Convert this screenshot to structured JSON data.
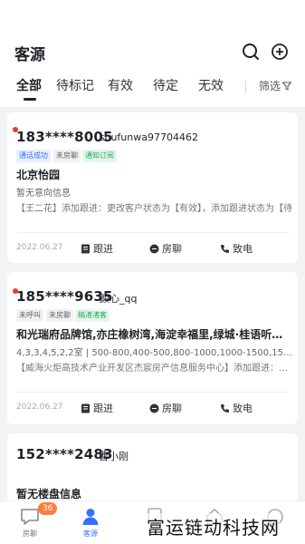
{
  "header": {
    "title": "客源"
  },
  "tabs": [
    {
      "label": "全部"
    },
    {
      "label": "待标记"
    },
    {
      "label": "有效"
    },
    {
      "label": "待定"
    },
    {
      "label": "无效"
    }
  ],
  "filter": {
    "label": "筛选"
  },
  "cards": [
    {
      "phone": "183****8005",
      "nickname": "soufunwa97704462",
      "tags": [
        "通话成功",
        "未房聊",
        "通知订阅"
      ],
      "estate": "北京怡园",
      "intent": "暂无意向信息",
      "follow": "【王二花】添加跟进：更改客户状态为【有效】，添加跟进状态为【待",
      "date": "2022.06.27",
      "actions": [
        "跟进",
        "房聊",
        "致电"
      ]
    },
    {
      "phone": "185****9635",
      "nickname": "颜心_qq",
      "tags": [
        "未呼叫",
        "未房聊",
        "稿渚渚客"
      ],
      "estate": "和光瑞府品牌馆,亦庄橡树湾,海淀幸福里,绿城·桂语听澜,...",
      "intent": "4,3,3,4,5,2,2室 | 500-800,400-500,800-1000,1000-1500,1500-...",
      "follow": "【威海火炬高技术产业开发区杰宸房产信息服务中心】添加跟进：更改客户",
      "date": "2022.06.27",
      "actions": [
        "跟进",
        "房聊",
        "致电"
      ]
    },
    {
      "phone": "152****2483",
      "nickname": "曹小刚",
      "estate": "暂无楼盘信息"
    }
  ],
  "bottom_nav": {
    "items": [
      {
        "label": "房聊",
        "badge": "36"
      },
      {
        "label": "客源"
      }
    ]
  },
  "watermark": "富运链动科技网",
  "colors": {
    "accent": "#3370ff",
    "dot": "#e83a2e",
    "badge": "#ff7d3f"
  }
}
